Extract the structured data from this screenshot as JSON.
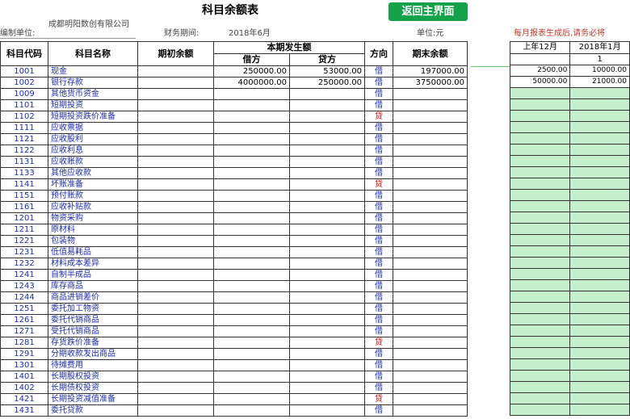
{
  "page_title": "科目余额表",
  "return_button": "返回主界面",
  "header": {
    "unit_label": "编制单位:",
    "company": "成都明阳数创有限公司",
    "period_label": "财务期间:",
    "period_value": "2018年6月",
    "currency_label": "单位:元"
  },
  "notice": "每月报表生成后,请务必将",
  "columns": {
    "code": "科目代码",
    "name": "科目名称",
    "opening": "期初余额",
    "current": "本期发生额",
    "debit": "借方",
    "credit": "贷方",
    "direction": "方向",
    "closing": "期末余额"
  },
  "rows": [
    {
      "code": "1001",
      "name": "现金",
      "debit": "250000.00",
      "credit": "53000.00",
      "dir": "借",
      "closing": "197000.00"
    },
    {
      "code": "1002",
      "name": "银行存款",
      "debit": "4000000.00",
      "credit": "250000.00",
      "dir": "借",
      "closing": "3750000.00"
    },
    {
      "code": "1009",
      "name": "其他货币资金",
      "debit": "",
      "credit": "",
      "dir": "借",
      "closing": ""
    },
    {
      "code": "1101",
      "name": "短期投资",
      "debit": "",
      "credit": "",
      "dir": "借",
      "closing": ""
    },
    {
      "code": "1102",
      "name": "短期投资跌价准备",
      "debit": "",
      "credit": "",
      "dir": "贷",
      "closing": ""
    },
    {
      "code": "1111",
      "name": "应收票据",
      "debit": "",
      "credit": "",
      "dir": "借",
      "closing": ""
    },
    {
      "code": "1121",
      "name": "应收股利",
      "debit": "",
      "credit": "",
      "dir": "借",
      "closing": ""
    },
    {
      "code": "1122",
      "name": "应收利息",
      "debit": "",
      "credit": "",
      "dir": "借",
      "closing": ""
    },
    {
      "code": "1131",
      "name": "应收账款",
      "debit": "",
      "credit": "",
      "dir": "借",
      "closing": ""
    },
    {
      "code": "1133",
      "name": "其他应收款",
      "debit": "",
      "credit": "",
      "dir": "借",
      "closing": ""
    },
    {
      "code": "1141",
      "name": "坏账准备",
      "debit": "",
      "credit": "",
      "dir": "贷",
      "closing": ""
    },
    {
      "code": "1151",
      "name": "预付账款",
      "debit": "",
      "credit": "",
      "dir": "借",
      "closing": ""
    },
    {
      "code": "1161",
      "name": "应收补贴款",
      "debit": "",
      "credit": "",
      "dir": "借",
      "closing": ""
    },
    {
      "code": "1201",
      "name": "物资采购",
      "debit": "",
      "credit": "",
      "dir": "借",
      "closing": ""
    },
    {
      "code": "1211",
      "name": "原材料",
      "debit": "",
      "credit": "",
      "dir": "借",
      "closing": ""
    },
    {
      "code": "1221",
      "name": "包装物",
      "debit": "",
      "credit": "",
      "dir": "借",
      "closing": ""
    },
    {
      "code": "1231",
      "name": "低值易耗品",
      "debit": "",
      "credit": "",
      "dir": "借",
      "closing": ""
    },
    {
      "code": "1232",
      "name": "材料成本差异",
      "debit": "",
      "credit": "",
      "dir": "借",
      "closing": ""
    },
    {
      "code": "1241",
      "name": "自制半成品",
      "debit": "",
      "credit": "",
      "dir": "借",
      "closing": ""
    },
    {
      "code": "1243",
      "name": "库存商品",
      "debit": "",
      "credit": "",
      "dir": "借",
      "closing": ""
    },
    {
      "code": "1244",
      "name": "商品进销差价",
      "debit": "",
      "credit": "",
      "dir": "借",
      "closing": ""
    },
    {
      "code": "1251",
      "name": "委托加工物资",
      "debit": "",
      "credit": "",
      "dir": "借",
      "closing": ""
    },
    {
      "code": "1261",
      "name": "委托代销商品",
      "debit": "",
      "credit": "",
      "dir": "借",
      "closing": ""
    },
    {
      "code": "1271",
      "name": "受托代销商品",
      "debit": "",
      "credit": "",
      "dir": "借",
      "closing": ""
    },
    {
      "code": "1281",
      "name": "存货跌价准备",
      "debit": "",
      "credit": "",
      "dir": "贷",
      "closing": ""
    },
    {
      "code": "1291",
      "name": "分期收款发出商品",
      "debit": "",
      "credit": "",
      "dir": "借",
      "closing": ""
    },
    {
      "code": "1301",
      "name": "待摊费用",
      "debit": "",
      "credit": "",
      "dir": "借",
      "closing": ""
    },
    {
      "code": "1401",
      "name": "长期股权投资",
      "debit": "",
      "credit": "",
      "dir": "借",
      "closing": ""
    },
    {
      "code": "1402",
      "name": "长期债权投资",
      "debit": "",
      "credit": "",
      "dir": "借",
      "closing": ""
    },
    {
      "code": "1421",
      "name": "长期投资减值准备",
      "debit": "",
      "credit": "",
      "dir": "贷",
      "closing": ""
    },
    {
      "code": "1431",
      "name": "委托贷款",
      "debit": "",
      "credit": "",
      "dir": "借",
      "closing": ""
    }
  ],
  "side_panel": {
    "headers": [
      "上年12月",
      "2018年1月"
    ],
    "sub": [
      "",
      "1"
    ],
    "rows": [
      [
        "2500.00",
        "10000.00"
      ],
      [
        "50000.00",
        "21000.00"
      ]
    ]
  },
  "colors": {
    "button_bg": "#13a14a",
    "notice_text": "#c0392b",
    "code_text": "#1c2db0",
    "credit_dir_text": "#d40000",
    "side_fill": "#c6efce"
  }
}
